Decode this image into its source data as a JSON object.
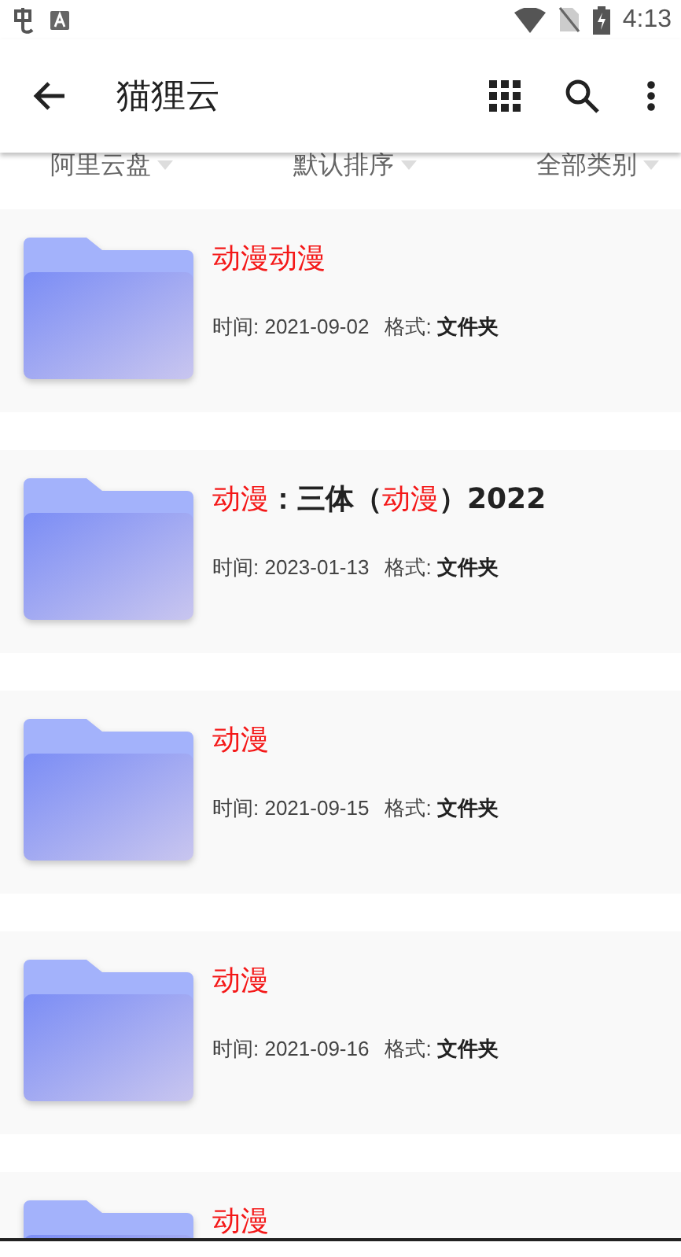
{
  "status_bar": {
    "time": "4:13"
  },
  "toolbar": {
    "title": "猫狸云"
  },
  "filters": [
    {
      "label": "阿里云盘"
    },
    {
      "label": "默认排序"
    },
    {
      "label": "全部类别"
    }
  ],
  "items": [
    {
      "title": [
        {
          "text": "动漫动漫",
          "highlight": true
        }
      ],
      "time_label": "时间:",
      "time": "2021-09-02",
      "format_label": "格式:",
      "format": "文件夹"
    },
    {
      "title": [
        {
          "text": "动漫",
          "highlight": true
        },
        {
          "text": "：三体（",
          "highlight": false
        },
        {
          "text": "动漫",
          "highlight": true
        },
        {
          "text": "）2022",
          "highlight": false
        }
      ],
      "time_label": "时间:",
      "time": "2023-01-13",
      "format_label": "格式:",
      "format": "文件夹"
    },
    {
      "title": [
        {
          "text": "动漫",
          "highlight": true
        }
      ],
      "time_label": "时间:",
      "time": "2021-09-15",
      "format_label": "格式:",
      "format": "文件夹"
    },
    {
      "title": [
        {
          "text": "动漫",
          "highlight": true
        }
      ],
      "time_label": "时间:",
      "time": "2021-09-16",
      "format_label": "格式:",
      "format": "文件夹"
    },
    {
      "title": [
        {
          "text": "动漫",
          "highlight": true
        }
      ]
    }
  ]
}
